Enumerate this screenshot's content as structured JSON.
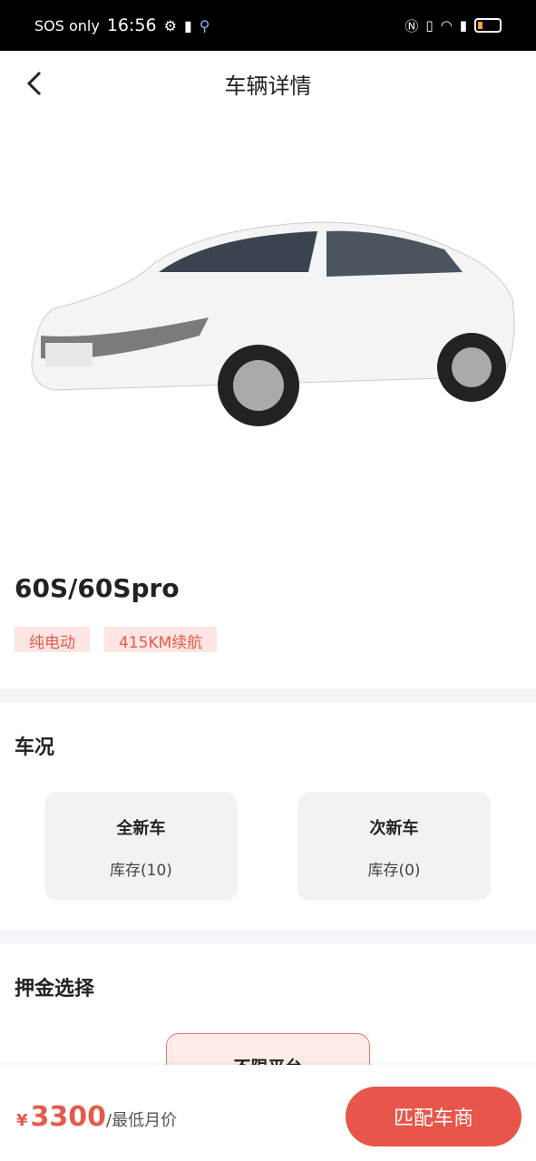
{
  "status_bar": {
    "carrier": "SOS only",
    "time": "16:56",
    "icons": [
      "gear-icon",
      "battery-alert-icon",
      "location-icon",
      "nfc-icon",
      "vibrate-icon",
      "wifi-icon",
      "sim-alert-icon",
      "battery-low-icon"
    ]
  },
  "nav": {
    "title": "车辆详情",
    "back_icon": "chevron-left-icon"
  },
  "vehicle": {
    "name": "60S/60Spro",
    "tags": [
      "纯电动",
      "415KM续航"
    ]
  },
  "condition": {
    "heading": "车况",
    "options": [
      {
        "label": "全新车",
        "stock": "库存(10)"
      },
      {
        "label": "次新车",
        "stock": "库存(0)"
      }
    ]
  },
  "deposit": {
    "heading": "押金选择",
    "options": [
      {
        "label": "不限平台",
        "selected": true
      }
    ]
  },
  "footer": {
    "currency": "¥",
    "price": "3300",
    "unit": "/最低月价",
    "button": "匹配车商"
  },
  "colors": {
    "accent": "#e8554a",
    "tag_bg": "#fde5e3",
    "card_bg": "#f2f2f2"
  }
}
